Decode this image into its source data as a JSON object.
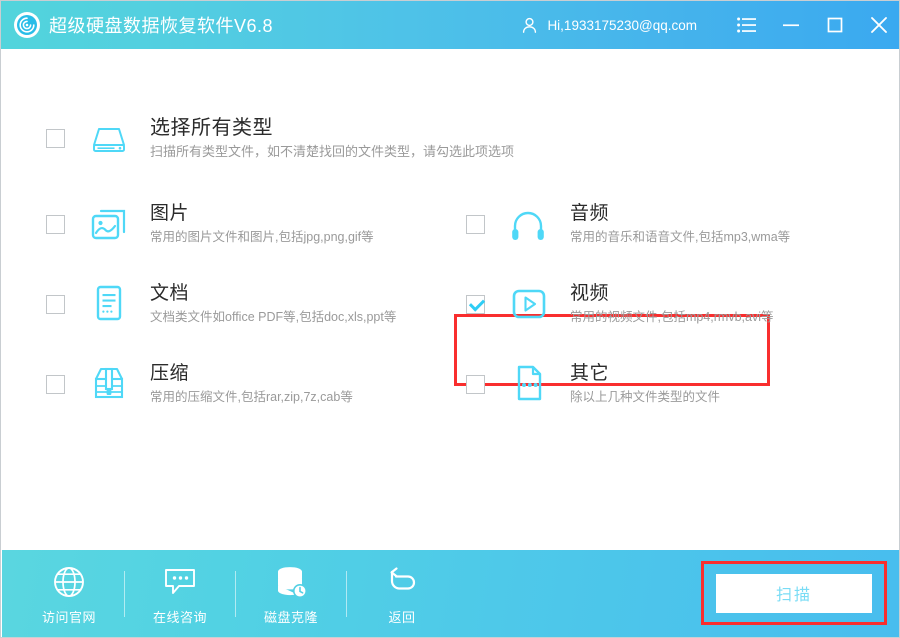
{
  "titlebar": {
    "logo_icon": "disc-recovery-logo-icon",
    "app_title": "超级硬盘数据恢复软件V6.8",
    "account_icon": "user-icon",
    "account_text": "Hi,1933175230@qq.com",
    "menu_icon": "list-menu-icon",
    "minimize_icon": "minimize-icon",
    "maximize_icon": "maximize-icon",
    "close_icon": "close-icon",
    "gradient_from": "#52d4dc",
    "gradient_to": "#3aa9f0"
  },
  "options": [
    {
      "key": "all",
      "icon": "hard-drive-icon",
      "title": "选择所有类型",
      "subtitle": "扫描所有类型文件，如不清楚找回的文件类型，请勾选此项选项",
      "checked": false
    },
    {
      "key": "pictures",
      "icon": "picture-icon",
      "title": "图片",
      "subtitle": "常用的图片文件和图片,包括jpg,png,gif等",
      "checked": false
    },
    {
      "key": "audio",
      "icon": "headphones-icon",
      "title": "音频",
      "subtitle": "常用的音乐和语音文件,包括mp3,wma等",
      "checked": false
    },
    {
      "key": "documents",
      "icon": "document-icon",
      "title": "文档",
      "subtitle": "文档类文件如office PDF等,包括doc,xls,ppt等",
      "checked": false
    },
    {
      "key": "video",
      "icon": "play-video-icon",
      "title": "视频",
      "subtitle": "常用的视频文件,包括mp4,rmvb,avi等",
      "checked": true,
      "highlighted": true
    },
    {
      "key": "archive",
      "icon": "archive-box-icon",
      "title": "压缩",
      "subtitle": "常用的压缩文件,包括rar,zip,7z,cab等",
      "checked": false
    },
    {
      "key": "other",
      "icon": "other-file-icon",
      "title": "其它",
      "subtitle": "除以上几种文件类型的文件",
      "checked": false
    }
  ],
  "footer": {
    "items": [
      {
        "icon": "globe-icon",
        "label": "访问官网"
      },
      {
        "icon": "chat-bubble-icon",
        "label": "在线咨询"
      },
      {
        "icon": "disk-clone-icon",
        "label": "磁盘克隆"
      },
      {
        "icon": "back-arrow-icon",
        "label": "返回"
      }
    ],
    "scan_button_label": "扫描"
  },
  "colors": {
    "accent_cyan": "#2ecdf5",
    "highlight_red": "#f92e2e",
    "title_text": "#2b2b2b",
    "sub_text": "#9a9a9a",
    "scan_text": "#79dcf5"
  }
}
